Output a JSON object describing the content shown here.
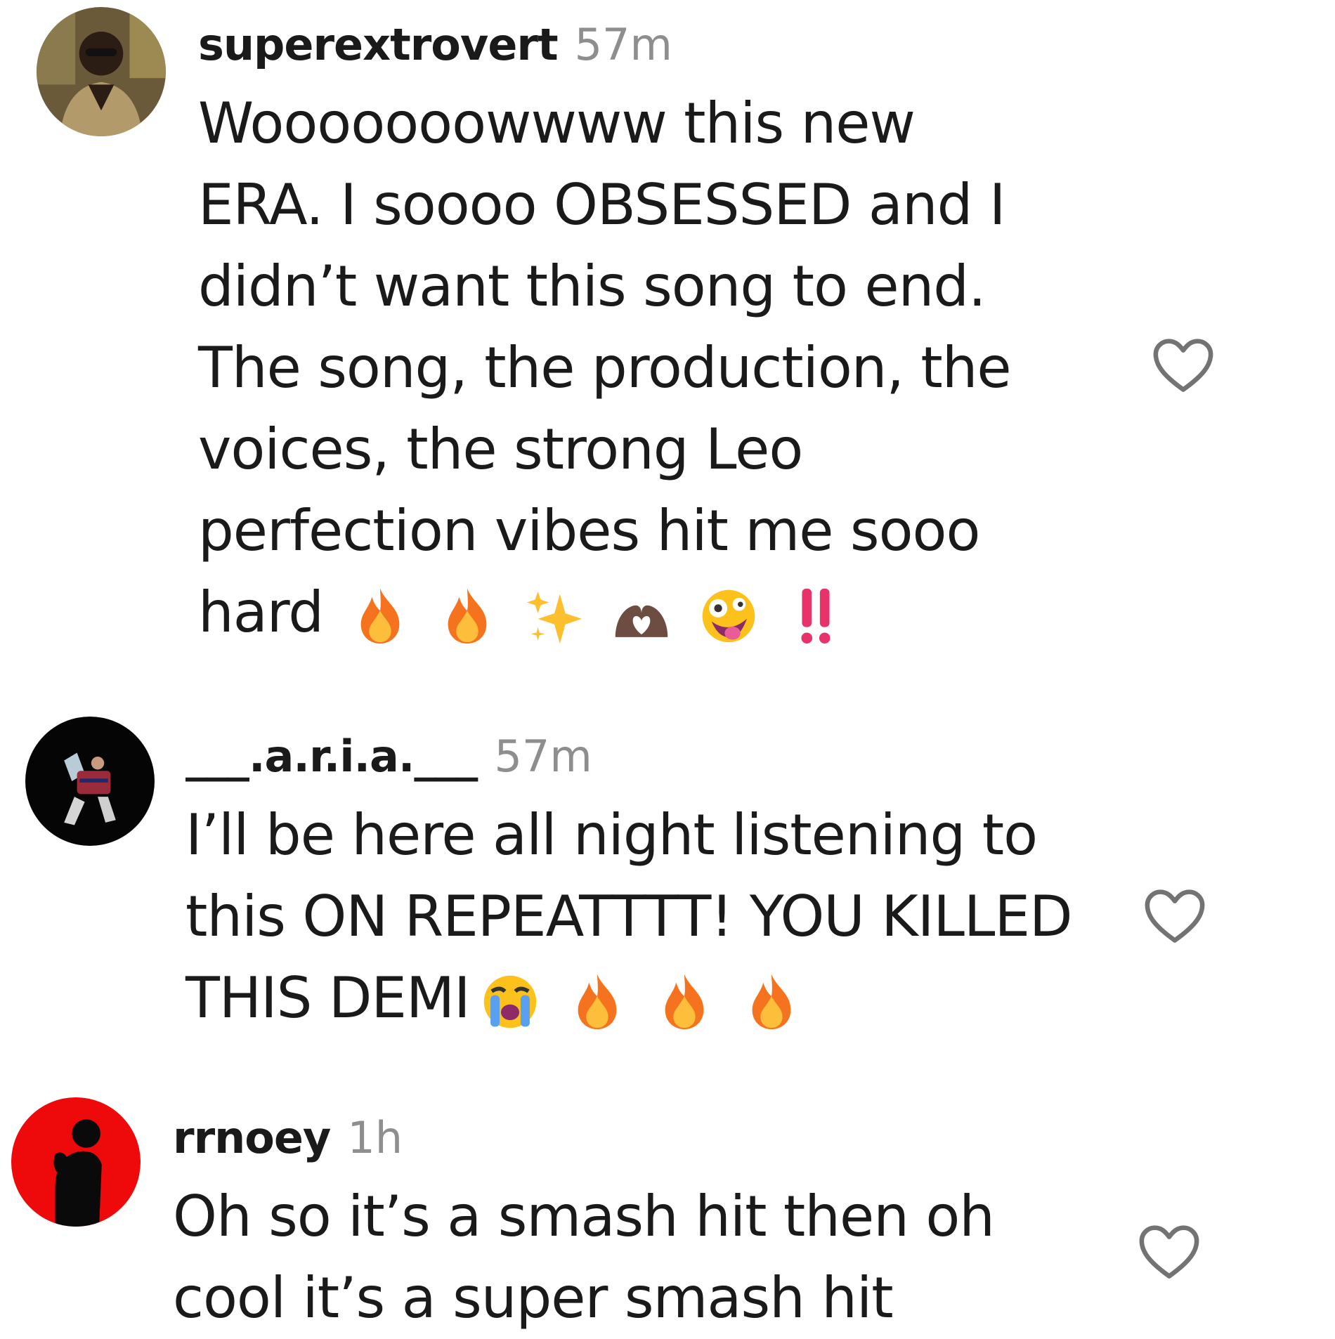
{
  "comments": [
    {
      "username": "superextrovert",
      "time": "57m",
      "lines": [
        "Wooooooowwww this new",
        "ERA. I soooo OBSESSED and I",
        "didn’t want this song to end.",
        "The song, the production, the",
        "voices, the strong Leo",
        "perfection vibes hit me sooo",
        "hard"
      ],
      "emojis": [
        "fire-emoji",
        "fire-emoji",
        "sparkles-emoji",
        "heart-hands-emoji",
        "zany-face-emoji",
        "double-exclamation-emoji"
      ]
    },
    {
      "username": "___.a.r.i.a.___",
      "time": "57m",
      "lines": [
        "I’ll be here all night listening to",
        "this ON REPEATTTT! YOU KILLED",
        "THIS DEMI"
      ],
      "emojis": [
        "crying-face-emoji",
        "fire-emoji",
        "fire-emoji",
        "fire-emoji"
      ]
    },
    {
      "username": "rrnoey",
      "time": "1h",
      "lines": [
        "Oh so it’s a smash hit then oh",
        "cool it’s a super smash hit"
      ],
      "emojis": []
    }
  ],
  "icons": {
    "like": "heart-outline-icon"
  },
  "colors": {
    "text": "#1a1a1a",
    "timestamp": "#8e8e8e",
    "icon": "#737373",
    "rrnoey_avatar_bg": "#ee0a0a"
  }
}
